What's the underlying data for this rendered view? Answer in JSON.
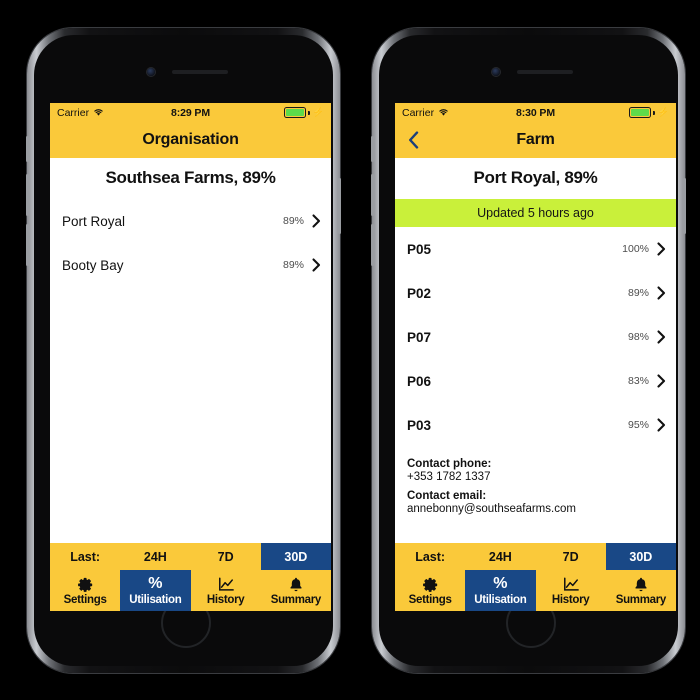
{
  "phones": [
    {
      "id": "organisation-screen",
      "statusbar": {
        "carrier": "Carrier",
        "wifi_icon": "wifi-icon",
        "time": "8:29 PM",
        "battery_icon": "battery-charging-icon",
        "bolt": "⚡"
      },
      "navbar": {
        "title": "Organisation",
        "has_back": false,
        "back_icon": "chevron-left-icon"
      },
      "page_title": "Southsea Farms, 89%",
      "updated_banner": null,
      "rows": [
        {
          "name": "Port Royal",
          "value": "89%",
          "bold": false
        },
        {
          "name": "Booty Bay",
          "value": "89%",
          "bold": false
        }
      ],
      "contact": null,
      "range": {
        "label": "Last:",
        "options": [
          "24H",
          "7D",
          "30D"
        ],
        "selected": "30D"
      },
      "tabs": [
        {
          "label": "Settings",
          "icon": "gear-icon",
          "selected": false
        },
        {
          "label": "Utilisation",
          "icon": "percent-icon",
          "selected": true
        },
        {
          "label": "History",
          "icon": "line-chart-icon",
          "selected": false
        },
        {
          "label": "Summary",
          "icon": "bell-icon",
          "selected": false
        }
      ]
    },
    {
      "id": "farm-screen",
      "statusbar": {
        "carrier": "Carrier",
        "wifi_icon": "wifi-icon",
        "time": "8:30 PM",
        "battery_icon": "battery-charging-icon",
        "bolt": "⚡"
      },
      "navbar": {
        "title": "Farm",
        "has_back": true,
        "back_icon": "chevron-left-icon"
      },
      "page_title": "Port Royal, 89%",
      "updated_banner": "Updated 5 hours ago",
      "rows": [
        {
          "name": "P05",
          "value": "100%",
          "bold": true
        },
        {
          "name": "P02",
          "value": "89%",
          "bold": true
        },
        {
          "name": "P07",
          "value": "98%",
          "bold": true
        },
        {
          "name": "P06",
          "value": "83%",
          "bold": true
        },
        {
          "name": "P03",
          "value": "95%",
          "bold": true
        }
      ],
      "contact": {
        "phone_label": "Contact phone:",
        "phone_value": "+353 1782 1337",
        "email_label": "Contact email:",
        "email_value": "annebonny@southseafarms.com"
      },
      "range": {
        "label": "Last:",
        "options": [
          "24H",
          "7D",
          "30D"
        ],
        "selected": "30D"
      },
      "tabs": [
        {
          "label": "Settings",
          "icon": "gear-icon",
          "selected": false
        },
        {
          "label": "Utilisation",
          "icon": "percent-icon",
          "selected": true
        },
        {
          "label": "History",
          "icon": "line-chart-icon",
          "selected": false
        },
        {
          "label": "Summary",
          "icon": "bell-icon",
          "selected": false
        }
      ]
    }
  ],
  "colors": {
    "brand_yellow": "#fac93a",
    "accent_navy": "#194886",
    "status_green": "#c9f03a",
    "battery_green": "#5ddb4a",
    "text_dark": "#111111"
  },
  "glyphs": {
    "percent": "%"
  }
}
